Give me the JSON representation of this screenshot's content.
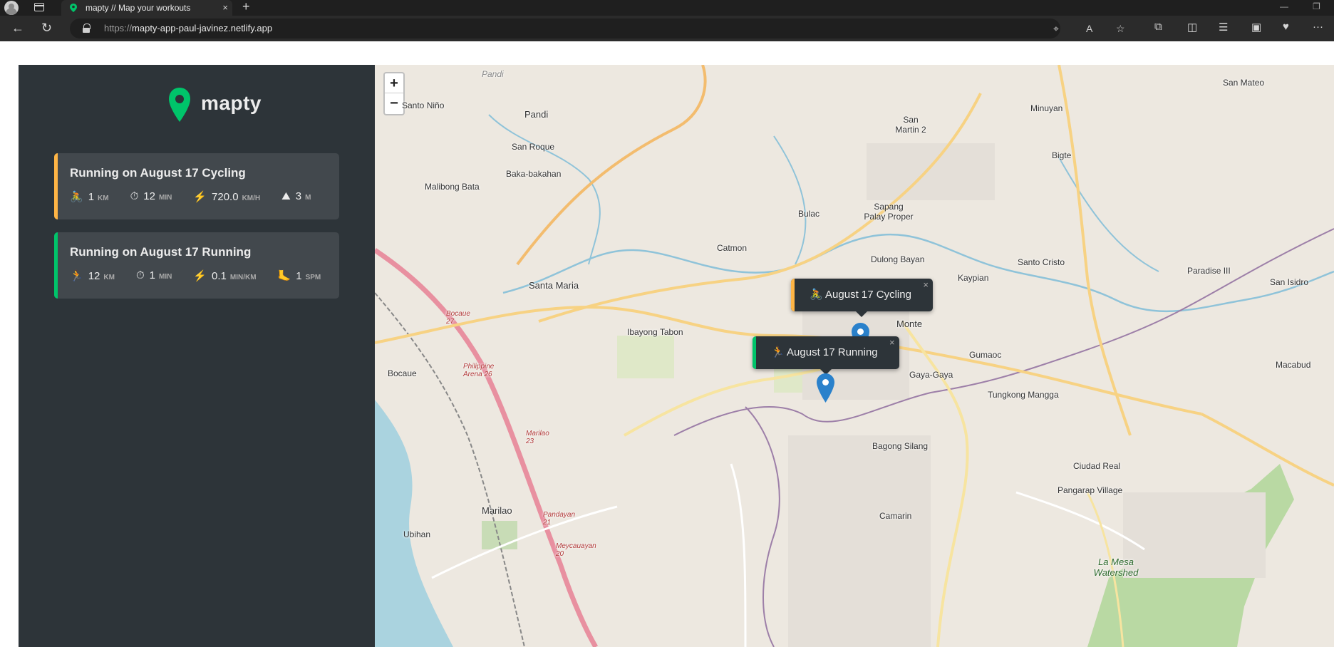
{
  "browser": {
    "tab_title": "mapty // Map your workouts",
    "tab_close": "×",
    "new_tab": "+",
    "url_scheme": "https://",
    "url_host": "mapty-app-paul-javinez.netlify.app",
    "win_min": "—",
    "win_restore": "❐",
    "more_label": "···"
  },
  "app": {
    "logo_text": "mapty",
    "brand_color": "#00c46a",
    "cycling_color": "#ffb545",
    "running_color": "#00c46a"
  },
  "workouts": [
    {
      "type": "cycling",
      "title": "Running on August 17 Cycling",
      "details": [
        {
          "icon": "cyclist-icon",
          "glyph": "🚴",
          "value": "1",
          "unit": "KM"
        },
        {
          "icon": "stopwatch-icon",
          "glyph": "⏱",
          "value": "12",
          "unit": "MIN"
        },
        {
          "icon": "lightning-icon",
          "glyph": "⚡",
          "value": "720.0",
          "unit": "KM/H"
        },
        {
          "icon": "mountain-icon",
          "glyph": "⛰",
          "value": "3",
          "unit": "M"
        }
      ]
    },
    {
      "type": "running",
      "title": "Running on August 17 Running",
      "details": [
        {
          "icon": "runner-icon",
          "glyph": "🏃",
          "value": "12",
          "unit": "KM"
        },
        {
          "icon": "stopwatch-icon",
          "glyph": "⏱",
          "value": "1",
          "unit": "MIN"
        },
        {
          "icon": "lightning-icon",
          "glyph": "⚡",
          "value": "0.1",
          "unit": "MIN/KM"
        },
        {
          "icon": "footprint-icon",
          "glyph": "🦶",
          "value": "1",
          "unit": "SPM"
        }
      ]
    }
  ],
  "map": {
    "zoom_in": "+",
    "zoom_out": "−",
    "popups": [
      {
        "type": "cycling",
        "glyph": "🚴",
        "label": "August 17 Cycling",
        "close": "×"
      },
      {
        "type": "running",
        "glyph": "🏃",
        "label": "August 17 Running",
        "close": "×"
      }
    ],
    "places": [
      {
        "name": "Pandi"
      },
      {
        "name": "Pandi"
      },
      {
        "name": "Santo Niño"
      },
      {
        "name": "San Roque"
      },
      {
        "name": "Baka-bakahan"
      },
      {
        "name": "Malibong Bata"
      },
      {
        "name": "San Martin 2"
      },
      {
        "name": "Minuyan"
      },
      {
        "name": "San Mateo"
      },
      {
        "name": "Bigte"
      },
      {
        "name": "Sapang Palay Proper"
      },
      {
        "name": "Bulac"
      },
      {
        "name": "Catmon"
      },
      {
        "name": "Dulong Bayan"
      },
      {
        "name": "Santo Cristo"
      },
      {
        "name": "Paradise III"
      },
      {
        "name": "San Isidro"
      },
      {
        "name": "Kaypian"
      },
      {
        "name": "Santa Maria"
      },
      {
        "name": "Ibayong Tabon"
      },
      {
        "name": "Monte"
      },
      {
        "name": "Gumaoc"
      },
      {
        "name": "Bocaue"
      },
      {
        "name": "Gaya-Gaya"
      },
      {
        "name": "Tungkong Mangga"
      },
      {
        "name": "Macabud"
      },
      {
        "name": "Bagong Silang"
      },
      {
        "name": "Ciudad Real"
      },
      {
        "name": "Pangarap Village"
      },
      {
        "name": "Marilao"
      },
      {
        "name": "Ubihan"
      },
      {
        "name": "Camarin"
      },
      {
        "name": "La Mesa Watershed"
      },
      {
        "name": "Bocaue 27"
      },
      {
        "name": "Philippine Arena 26"
      },
      {
        "name": "Marilao 23"
      },
      {
        "name": "Pandayan 21"
      },
      {
        "name": "Meycauayan 20"
      }
    ]
  }
}
